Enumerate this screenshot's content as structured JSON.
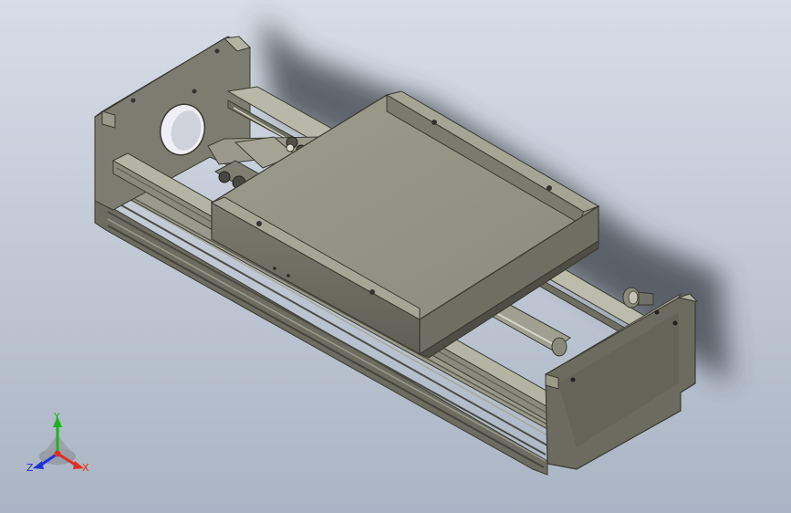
{
  "viewport": {
    "background_top": "#d7dde6",
    "background_bottom": "#aab4c3"
  },
  "model": {
    "name": "linear-stage-module",
    "body_color": "#8a8a7c",
    "dark_color": "#55554c",
    "light_color": "#b2b2a4"
  },
  "triad": {
    "x_label": "X",
    "y_label": "Y",
    "z_label": "Z",
    "x_color": "#e03020",
    "y_color": "#20b020",
    "z_color": "#2030e0"
  }
}
